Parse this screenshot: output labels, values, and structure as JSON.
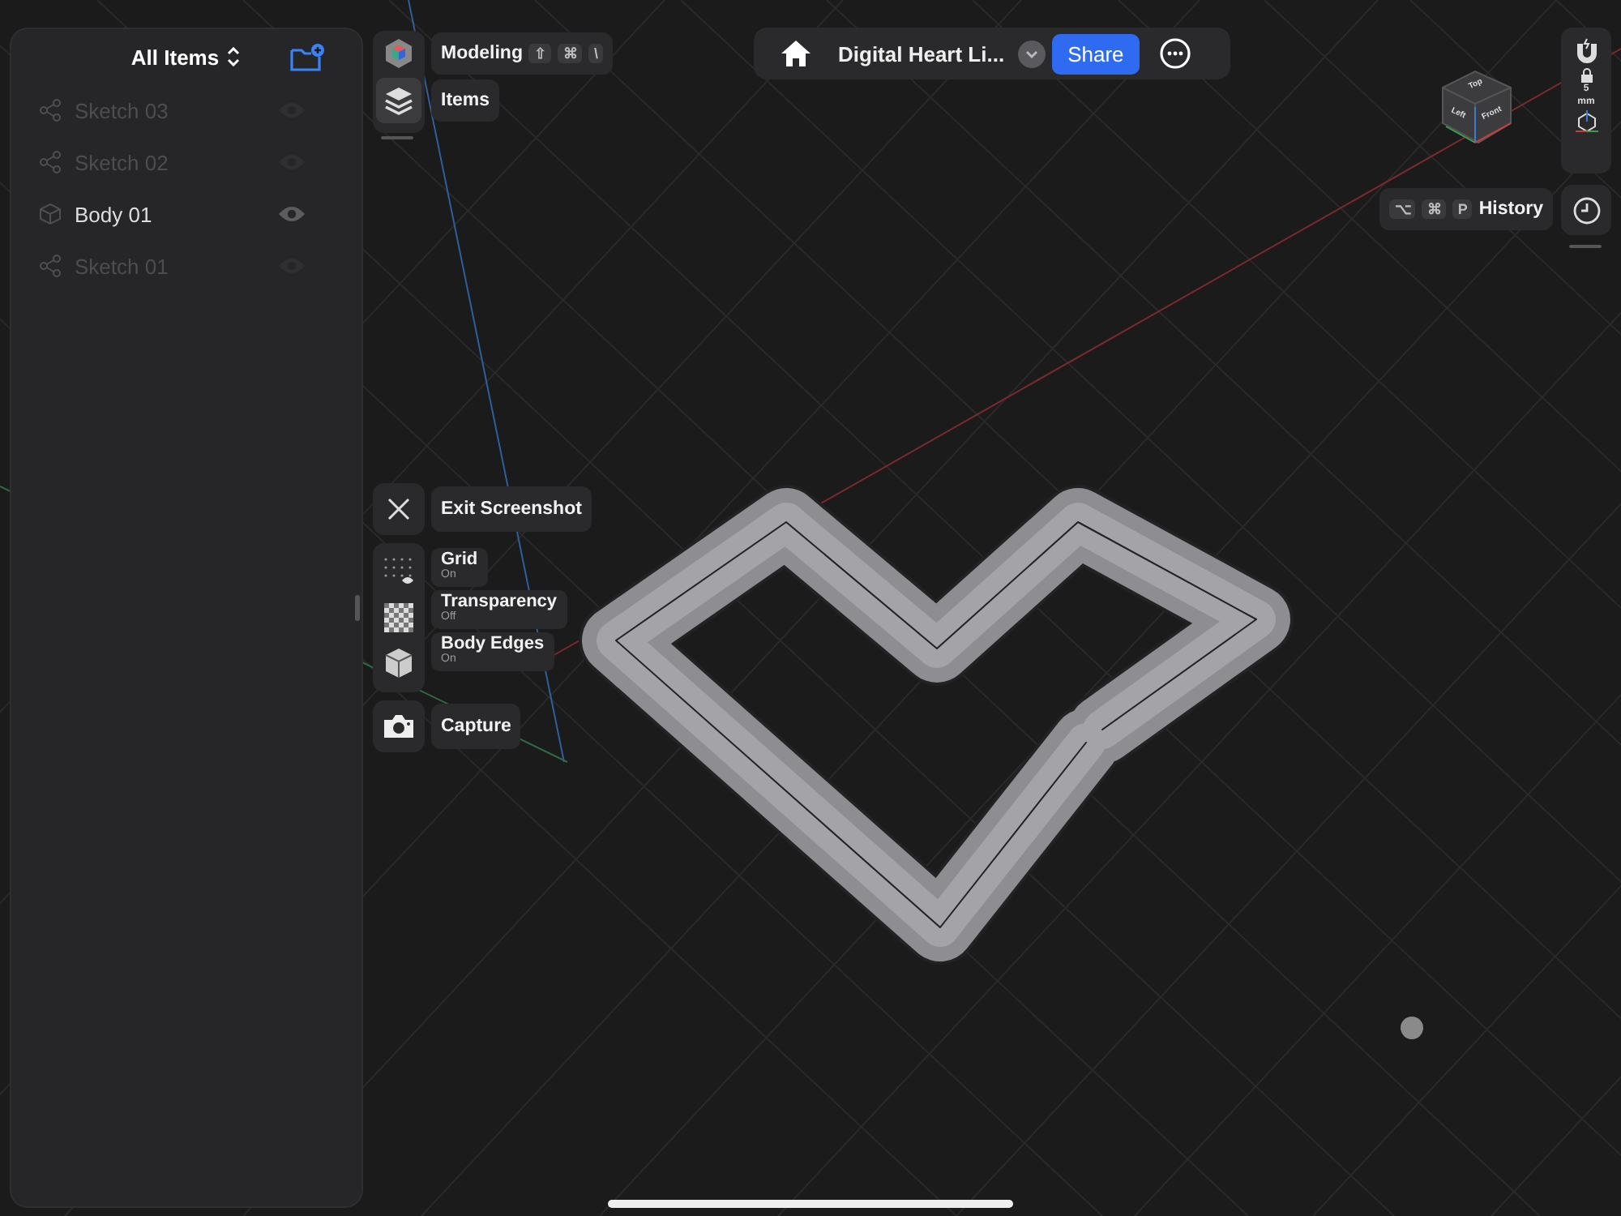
{
  "sidebar": {
    "title": "All Items",
    "items": [
      {
        "name": "Sketch 03",
        "kind": "sketch",
        "visible": false
      },
      {
        "name": "Sketch 02",
        "kind": "sketch",
        "visible": false
      },
      {
        "name": "Body 01",
        "kind": "body",
        "visible": true
      },
      {
        "name": "Sketch 01",
        "kind": "sketch",
        "visible": false
      }
    ]
  },
  "workspace": {
    "label": "Modeling",
    "shortcut": [
      "⇧",
      "⌘",
      "\\"
    ]
  },
  "items_button": {
    "label": "Items"
  },
  "document": {
    "title": "Digital Heart Li...",
    "share": "Share"
  },
  "view_cube": {
    "faces": [
      "Top",
      "Left",
      "Front"
    ]
  },
  "snap": {
    "value": "5",
    "unit": "mm"
  },
  "history": {
    "label": "History",
    "shortcut": [
      "⌥",
      "⌘",
      "P"
    ]
  },
  "screenshot_menu": {
    "exit": "Exit Screenshot",
    "toggles": [
      {
        "label": "Grid",
        "status": "On",
        "kind": "grid"
      },
      {
        "label": "Transparency",
        "status": "Off",
        "kind": "transparency"
      },
      {
        "label": "Body Edges",
        "status": "On",
        "kind": "edges"
      }
    ],
    "capture": "Capture"
  }
}
